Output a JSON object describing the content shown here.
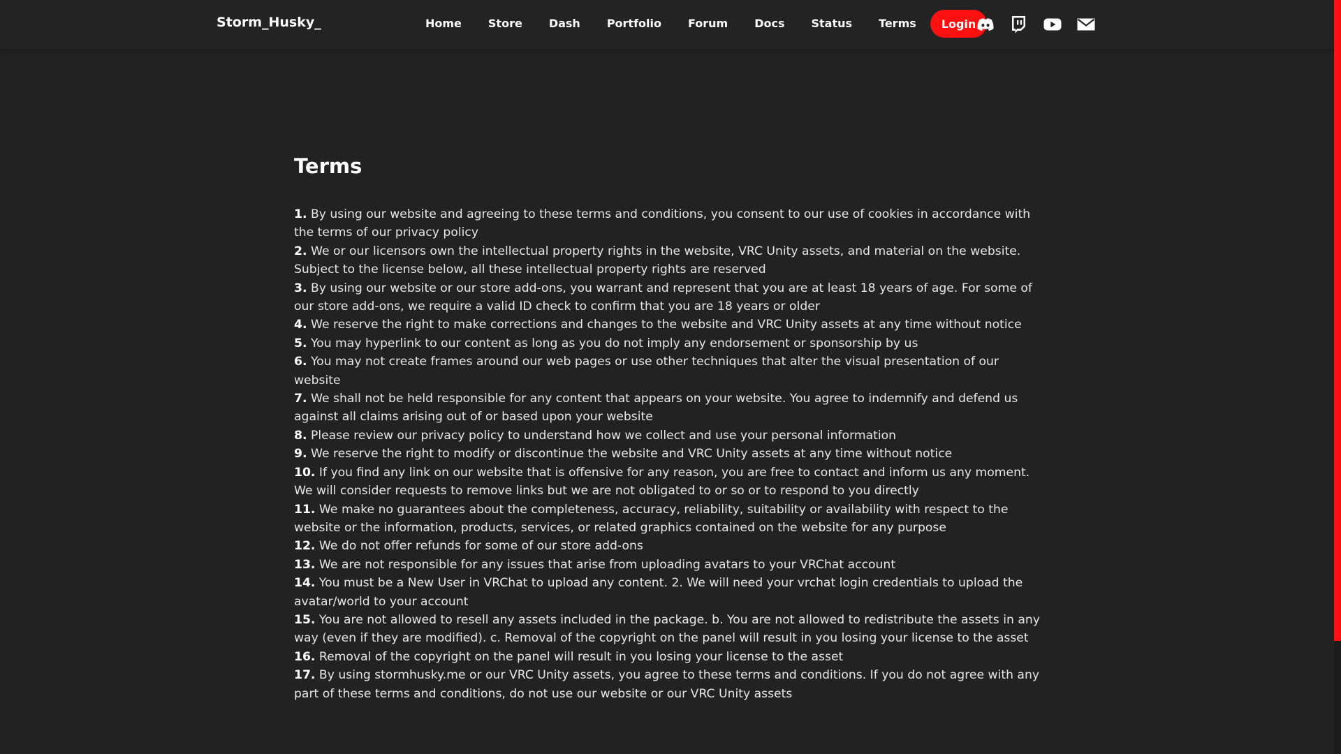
{
  "nav": {
    "brand": "Storm_Husky_",
    "links": [
      "Home",
      "Store",
      "Dash",
      "Portfolio",
      "Forum",
      "Docs",
      "Status",
      "Terms"
    ],
    "login_label": "Login",
    "social_icons": [
      "discord-icon",
      "twitch-icon",
      "youtube-icon",
      "mail-icon"
    ]
  },
  "colors": {
    "background": "#222222",
    "accent": "#ff1010",
    "text": "#e6e6e6"
  },
  "page": {
    "title": "Terms"
  },
  "terms": [
    {
      "num": "1.",
      "text": " By using our website and agreeing to these terms and conditions, you consent to our use of cookies in accordance with the terms of our privacy policy"
    },
    {
      "num": "2.",
      "text": " We or our licensors own the intellectual property rights in the website, VRC Unity assets, and material on the website. Subject to the license below, all these intellectual property rights are reserved"
    },
    {
      "num": "3.",
      "text": " By using our website or our store add-ons, you warrant and represent that you are at least 18 years of age. For some of our store add-ons, we require a valid ID check to confirm that you are 18 years or older"
    },
    {
      "num": "4.",
      "text": " We reserve the right to make corrections and changes to the website and VRC Unity assets at any time without notice"
    },
    {
      "num": "5.",
      "text": " You may hyperlink to our content as long as you do not imply any endorsement or sponsorship by us"
    },
    {
      "num": "6.",
      "text": " You may not create frames around our web pages or use other techniques that alter the visual presentation of our website"
    },
    {
      "num": "7.",
      "text": " We shall not be held responsible for any content that appears on your website. You agree to indemnify and defend us against all claims arising out of or based upon your website"
    },
    {
      "num": "8.",
      "text": " Please review our privacy policy to understand how we collect and use your personal information"
    },
    {
      "num": "9.",
      "text": " We reserve the right to modify or discontinue the website and VRC Unity assets at any time without notice"
    },
    {
      "num": "10.",
      "text": " If you find any link on our website that is offensive for any reason, you are free to contact and inform us any moment. We will consider requests to remove links but we are not obligated to or so or to respond to you directly"
    },
    {
      "num": "11.",
      "text": " We make no guarantees about the completeness, accuracy, reliability, suitability or availability with respect to the website or the information, products, services, or related graphics contained on the website for any purpose"
    },
    {
      "num": "12.",
      "text": " We do not offer refunds for some of our store add-ons"
    },
    {
      "num": "13.",
      "text": " We are not responsible for any issues that arise from uploading avatars to your VRChat account"
    },
    {
      "num": "14.",
      "text": " You must be a New User in VRChat to upload any content. 2. We will need your vrchat login credentials to upload the avatar/world to your account"
    },
    {
      "num": "15.",
      "text": " You are not allowed to resell any assets included in the package. b. You are not allowed to redistribute the assets in any way (even if they are modified). c. Removal of the copyright on the panel will result in you losing your license to the asset"
    },
    {
      "num": "16.",
      "text": " Removal of the copyright on the panel will result in you losing your license to the asset"
    },
    {
      "num": "17.",
      "text": " By using stormhusky.me or our VRC Unity assets, you agree to these terms and conditions. If you do not agree with any part of these terms and conditions, do not use our website or our VRC Unity assets"
    }
  ]
}
